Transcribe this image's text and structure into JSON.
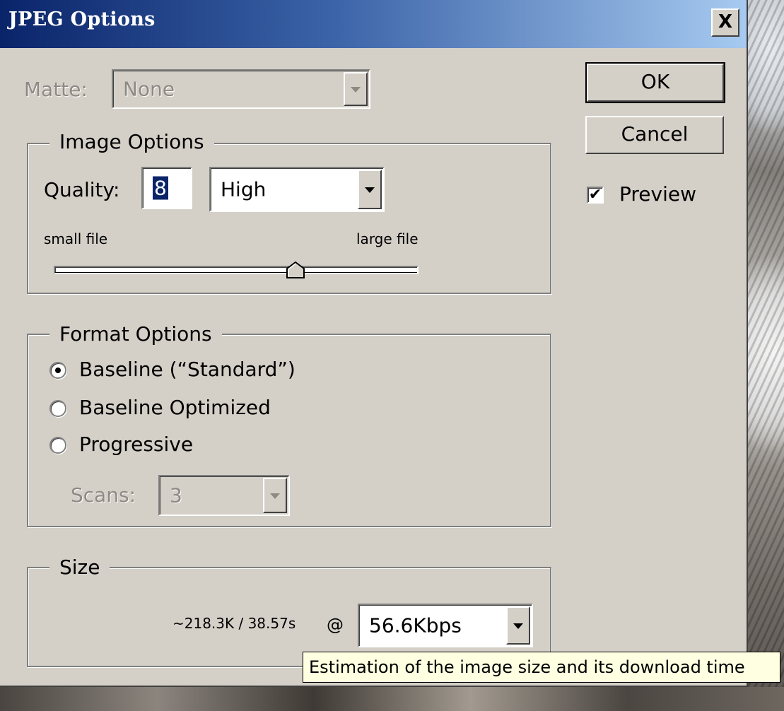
{
  "window": {
    "title": "JPEG Options",
    "close_label": "X"
  },
  "matte": {
    "label": "Matte:",
    "value": "None",
    "enabled": false
  },
  "buttons": {
    "ok": "OK",
    "cancel": "Cancel"
  },
  "preview": {
    "label": "Preview",
    "checked": true
  },
  "image_options": {
    "legend": "Image Options",
    "quality_label": "Quality:",
    "quality_value": "8",
    "quality_preset": "High",
    "small_label": "small file",
    "large_label": "large file",
    "slider_level": 8,
    "slider_max": 12
  },
  "format_options": {
    "legend": "Format Options",
    "radios": [
      {
        "label": "Baseline (“Standard”)",
        "checked": true
      },
      {
        "label": "Baseline Optimized",
        "checked": false
      },
      {
        "label": "Progressive",
        "checked": false
      }
    ],
    "scans_label": "Scans:",
    "scans_value": "3"
  },
  "size": {
    "legend": "Size",
    "estimate": "~218.3K / 38.57s",
    "at": "@",
    "speed": "56.6Kbps"
  },
  "tooltip": "Estimation of the image size and its download time"
}
